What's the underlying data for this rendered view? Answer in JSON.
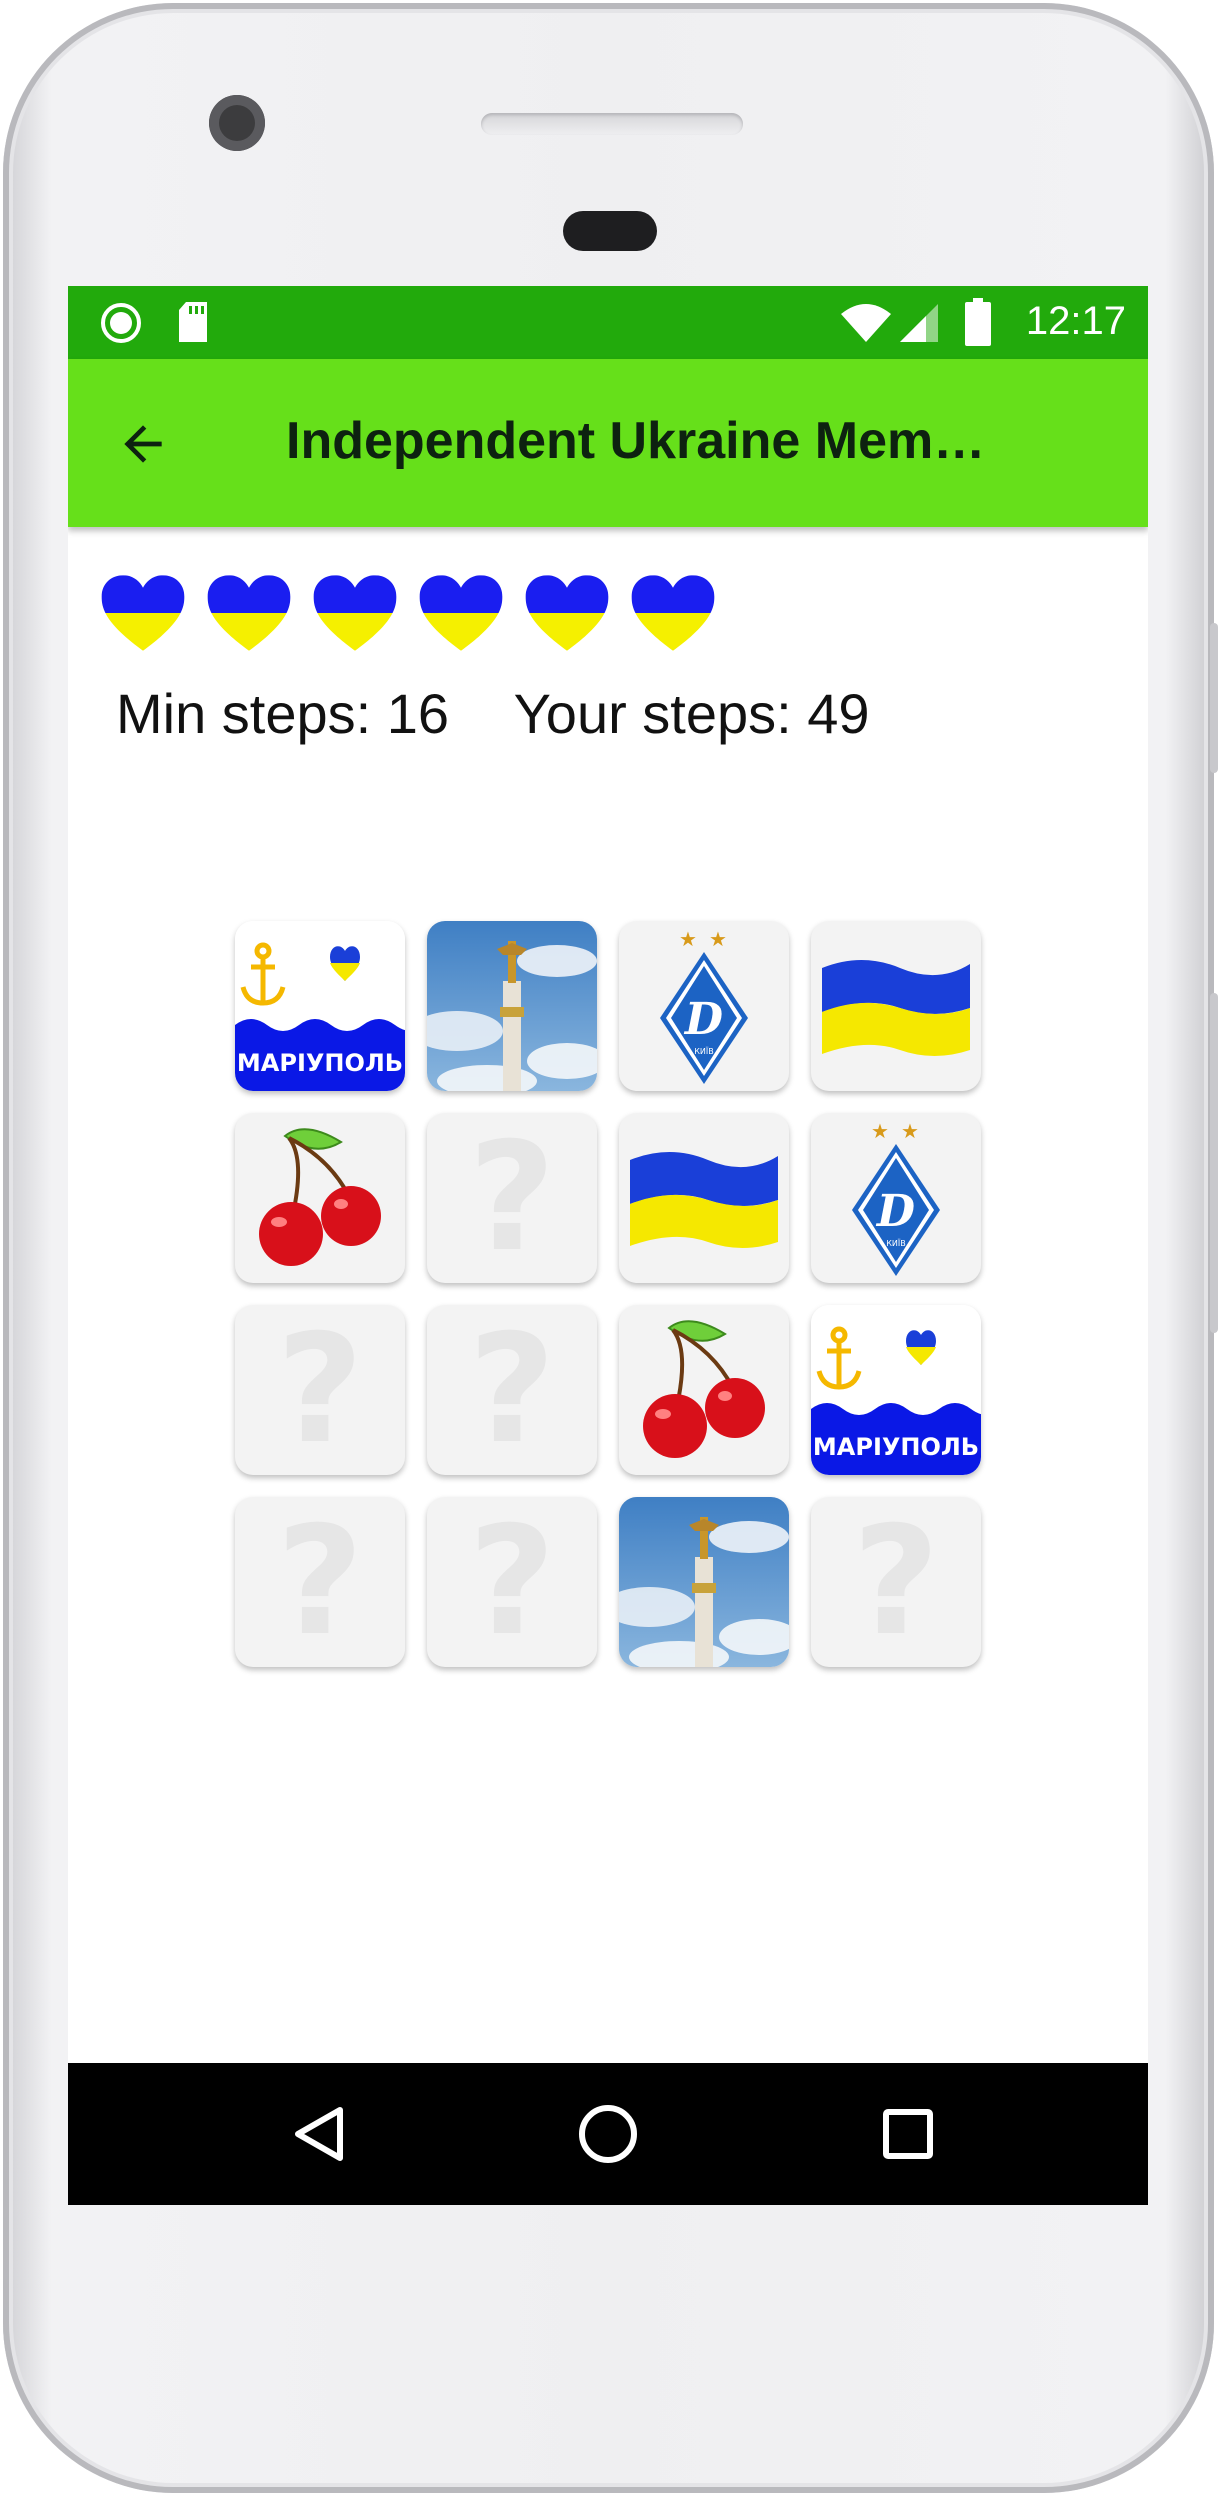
{
  "status_bar": {
    "time": "12:17"
  },
  "app_bar": {
    "title": "Independent Ukraine Mem…"
  },
  "hearts": {
    "count": 6,
    "top_color": "#1a1ef0",
    "bottom_color": "#f5f000"
  },
  "stats": {
    "min_steps_label": "Min steps: 16",
    "your_steps_label": "Your steps: 49"
  },
  "mariupol_label": "МАРІУПОЛЬ",
  "kyiv_label": "КИЇВ",
  "hidden_symbol": "?",
  "grid": [
    [
      "mariupol",
      "monument",
      "dynamo",
      "flag"
    ],
    [
      "cherry",
      "hidden",
      "flag",
      "dynamo"
    ],
    [
      "hidden",
      "hidden",
      "cherry",
      "mariupol"
    ],
    [
      "hidden",
      "hidden",
      "monument",
      "hidden"
    ]
  ],
  "colors": {
    "status_bar": "#22aa0c",
    "app_bar": "#66e01a",
    "flag_blue": "#1a3fd8",
    "flag_yellow": "#f5e800"
  }
}
